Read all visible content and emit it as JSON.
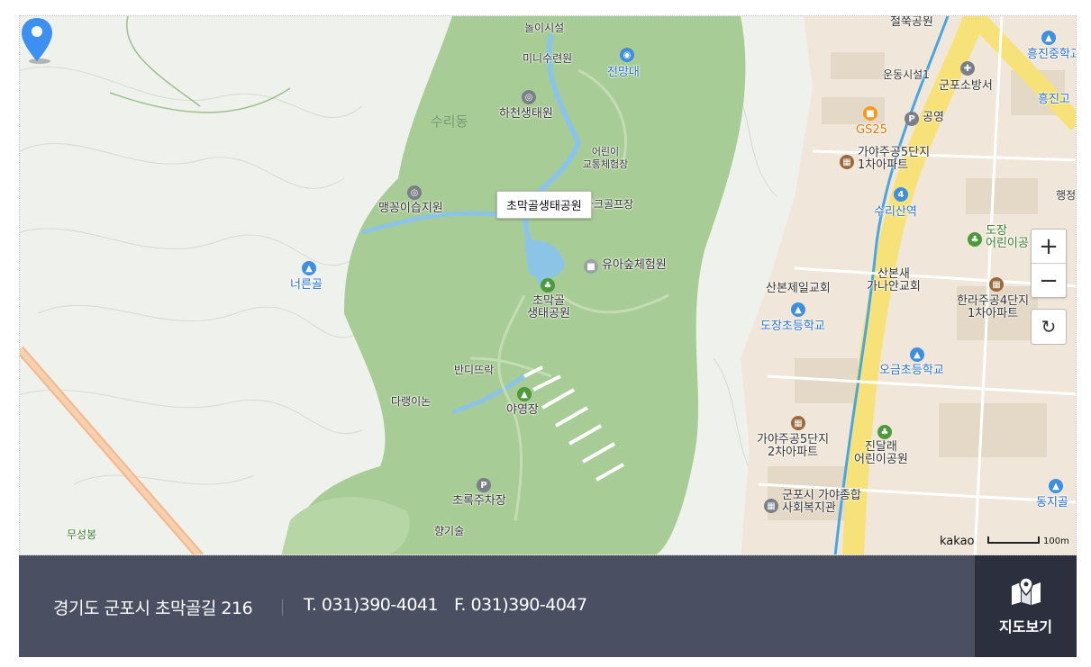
{
  "map": {
    "tooltip": "초막골생태공원",
    "labels": {
      "play": "놀이시설",
      "mini": "미니수련원",
      "observatory": "전망대",
      "hacheon": "하천생태원",
      "surido": "수리동",
      "kids_traffic": "어린이\n교통체험장",
      "maengkkong": "맹꽁이습지원",
      "park_golf": "파크골프장",
      "yua": "유아숲체험원",
      "chomakgol": "초막골\n생태공원",
      "neoreungol": "너른골",
      "bandi": "반디뜨락",
      "darang": "다랭이논",
      "camp": "야영장",
      "parking": "초록주차장",
      "hyanggisul": "향기술",
      "museongbong": "무성봉",
      "cheoljjuk": "철쭉공원",
      "exercise": "운동시설1",
      "fire": "군포소방서",
      "gs25": "GS25",
      "parking2": "공영",
      "gaya5_1": "가야주공5단지\n1차아파트",
      "surisan": "수리산역",
      "dojang_kids": "도장\n어린이공",
      "sanbon_church": "산본제일교회",
      "sanbonsae": "산본새\n가나안교회",
      "hanra": "한라주공4단지\n1차아파트",
      "dojang_elem": "도장초등학교",
      "ogeum": "오금초등학교",
      "gaya5_2": "가야주공5단지\n2차아파트",
      "jindallae": "진달래\n어린이공원",
      "welfare": "군포시 가야종합\n사회복지관",
      "heungjin_mid": "흥진중학교",
      "heungjin_high": "흥진고",
      "dongji": "동지골",
      "haeng": "행정"
    },
    "attribution": "kakao",
    "scale_label": "100m",
    "zoom_in": "+",
    "zoom_out": "−",
    "reset": "↻"
  },
  "footer": {
    "address": "경기도 군포시 초막골길 216",
    "tel": "T. 031)390-4041",
    "fax": "F. 031)390-4047",
    "map_button": "지도보기"
  },
  "colors": {
    "park": "#a8cc95",
    "water": "#8cc4e8",
    "urban": "#f0e7da",
    "road": "#f7e27a",
    "footer": "#4a4f62",
    "marker": "#3d8ff0"
  }
}
